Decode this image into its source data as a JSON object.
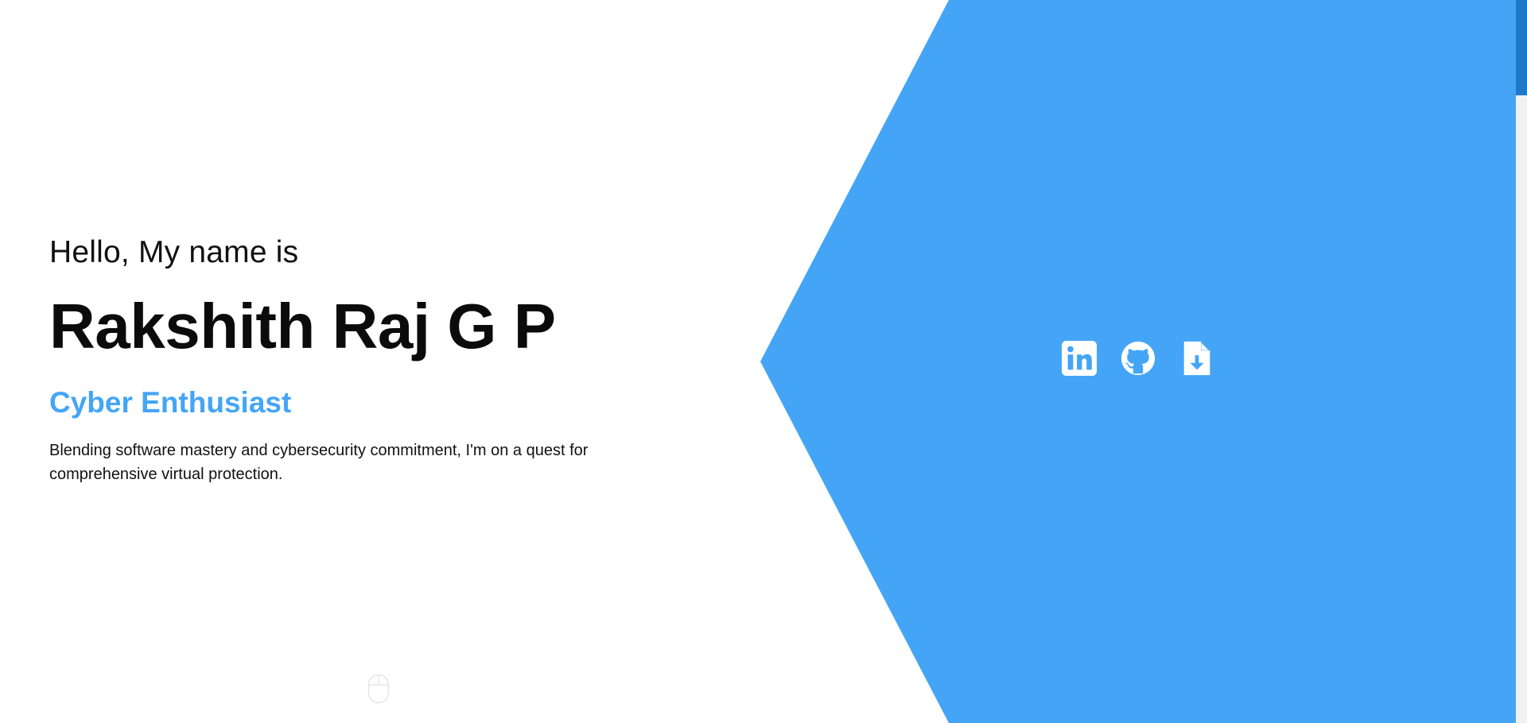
{
  "hero": {
    "greeting": "Hello, My name is",
    "name": "Rakshith Raj G P",
    "role": "Cyber Enthusiast",
    "bio": "Blending software mastery and cybersecurity commitment, I'm on a quest for comprehensive virtual protection."
  },
  "social": [
    {
      "icon": "linkedin-icon"
    },
    {
      "icon": "github-icon"
    },
    {
      "icon": "resume-download-icon"
    }
  ],
  "scroll_indicator": {
    "icon": "mouse-icon"
  },
  "colors": {
    "accent": "#44a5f6",
    "text": "#0b0b0b",
    "background": "#ffffff",
    "scrollbar_thumb": "#1f79c9"
  }
}
